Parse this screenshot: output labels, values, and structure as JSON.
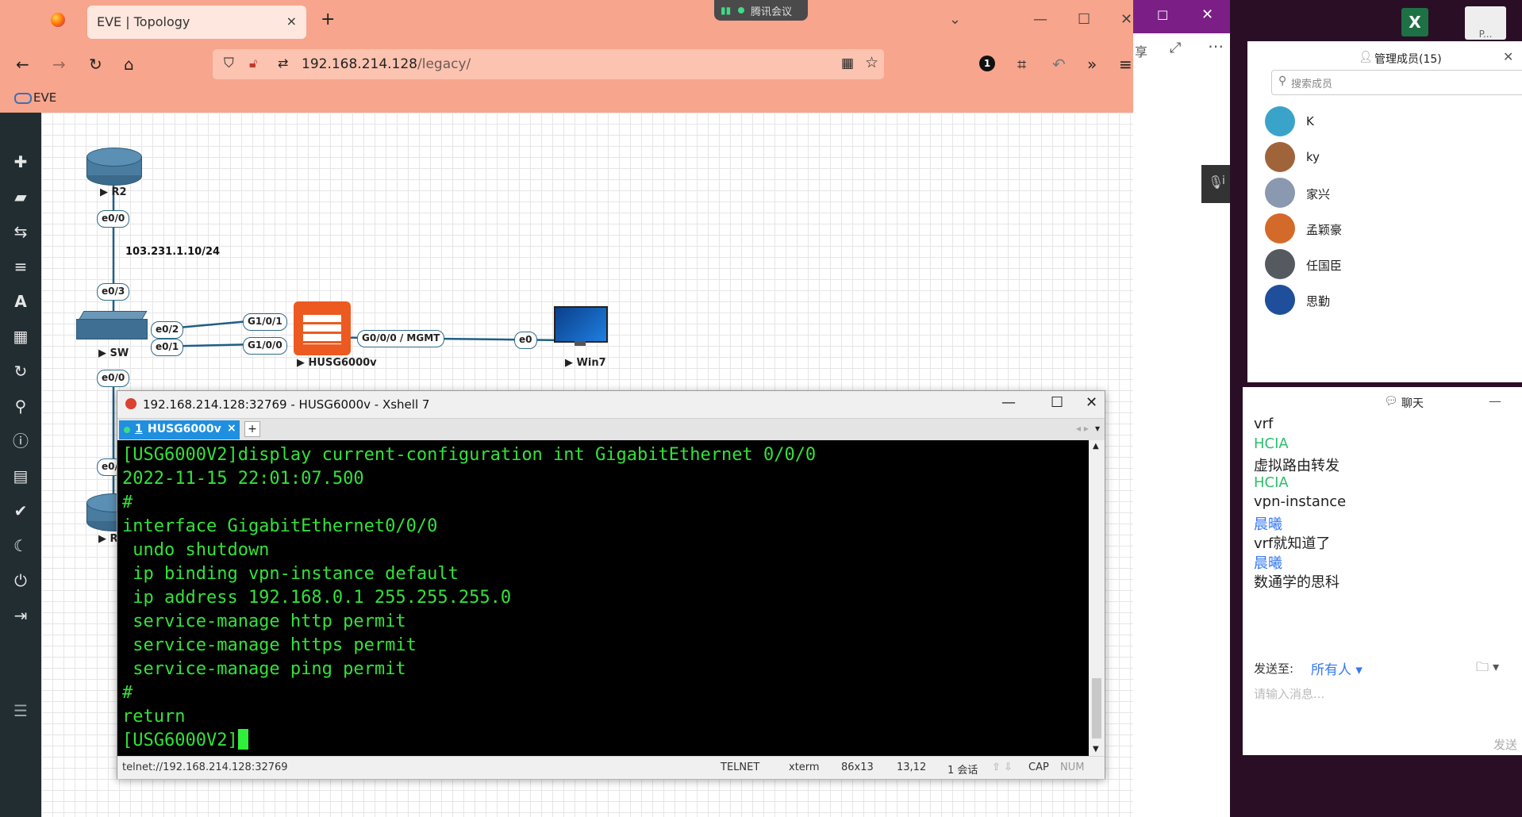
{
  "browser": {
    "tab_title": "EVE | Topology",
    "tab_close": "×",
    "new_tab": "+",
    "url_host": "192.168.214.128",
    "url_path": "/legacy/",
    "bookmark": "EVE",
    "meeting_badge": "腾讯会议",
    "window_controls": {
      "minimize": "—",
      "maximize": "☐",
      "close": "✕",
      "tabs_dropdown": "⌄"
    },
    "nav": {
      "back": "←",
      "forward": "→",
      "reload": "↻",
      "home": "⌂",
      "extension_badge": "1",
      "more": "»",
      "menu": "≡"
    }
  },
  "eve_toolbar": [
    "add-icon",
    "storage-icon",
    "network-icon",
    "list-icon",
    "text-icon",
    "grid-icon",
    "refresh-icon",
    "zoom-icon",
    "info-icon",
    "lab-details-icon",
    "status-icon",
    "dark-mode-icon",
    "power-icon",
    "logout-icon",
    "menu-icon"
  ],
  "topology": {
    "nodes": {
      "r2": "R2",
      "sw": "SW",
      "fw": "HUSG6000v",
      "win7": "Win7",
      "r_partial": "R"
    },
    "ports": {
      "r2_e00": "e0/0",
      "sw_e03": "e0/3",
      "sw_e02": "e0/2",
      "sw_e01": "e0/1",
      "sw_e00": "e0/0",
      "fw_g101": "G1/0/1",
      "fw_g100": "G1/0/0",
      "fw_mgmt": "G0/0/0 / MGMT",
      "win7_e0": "e0",
      "r_partial_port": "e0/"
    },
    "ip_label": "103.231.1.10/24"
  },
  "xshell": {
    "title": "192.168.214.128:32769 - HUSG6000v - Xshell 7",
    "tab_number": "1",
    "tab_name": "HUSG6000v",
    "tab_close": "×",
    "add_tab": "+",
    "terminal_lines": [
      "[USG6000V2]display current-configuration int GigabitEthernet 0/0/0",
      "2022-11-15 22:01:07.500",
      "#",
      "interface GigabitEthernet0/0/0",
      " undo shutdown",
      " ip binding vpn-instance default",
      " ip address 192.168.0.1 255.255.255.0",
      " service-manage http permit",
      " service-manage https permit",
      " service-manage ping permit",
      "#",
      "return",
      "[USG6000V2]"
    ],
    "status": {
      "connection": "telnet://192.168.214.128:32769",
      "protocol": "TELNET",
      "terminal": "xterm",
      "size": "86x13",
      "cursor_pos": "13,12",
      "sessions": "1 会话",
      "cap": "CAP",
      "num": "NUM"
    }
  },
  "meeting": {
    "members_title": "管理成员(15)",
    "search_placeholder": "搜索成员",
    "members": [
      "K",
      "ky",
      "家兴",
      "孟颖豪",
      "任国臣",
      "思勤"
    ],
    "chat_title": "聊天",
    "messages": [
      {
        "type": "msg",
        "text": "vrf"
      },
      {
        "type": "user",
        "text": "HCIA",
        "color": "#2dbd6e"
      },
      {
        "type": "msg",
        "text": "虚拟路由转发"
      },
      {
        "type": "user",
        "text": "HCIA",
        "color": "#2dbd6e"
      },
      {
        "type": "msg",
        "text": "vpn-instance"
      },
      {
        "type": "user",
        "text": "晨曦",
        "color": "#3478f6"
      },
      {
        "type": "msg",
        "text": "vrf就知道了"
      },
      {
        "type": "user",
        "text": "晨曦",
        "color": "#3478f6"
      },
      {
        "type": "msg",
        "text": "数通学的思科"
      }
    ],
    "send_to_label": "发送至:",
    "send_to_value": "所有人",
    "input_placeholder": "请输入消息...",
    "send_button": "发送",
    "side_label_share": "享",
    "side_label_i": "i"
  },
  "colors": {
    "browser_chrome": "#f7a58c",
    "terminal_text": "#33e23b",
    "eve_sidebar": "#222d32",
    "link_blue": "#2e6b8a"
  }
}
